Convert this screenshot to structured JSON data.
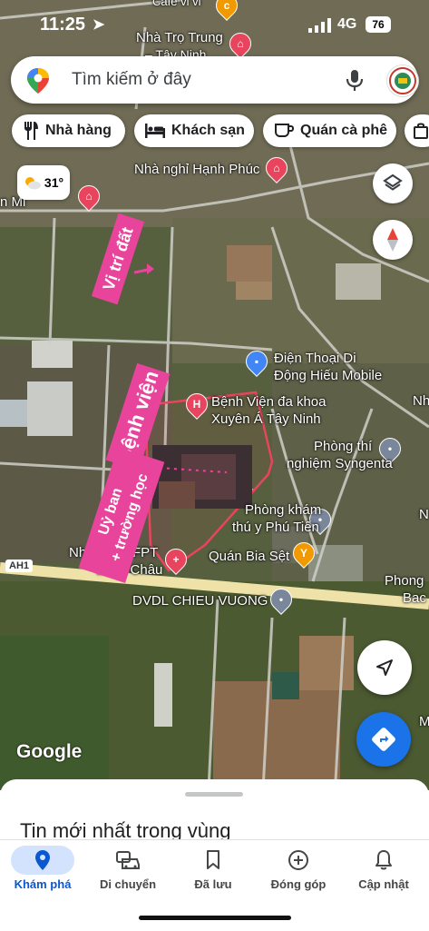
{
  "status_bar": {
    "time": "11:25",
    "network": "4G",
    "battery": "76"
  },
  "search": {
    "placeholder": "Tìm kiếm ở đây"
  },
  "chips": [
    {
      "label": "Nhà hàng",
      "icon": "fork-knife-icon"
    },
    {
      "label": "Khách sạn",
      "icon": "bed-icon"
    },
    {
      "label": "Quán cà phê",
      "icon": "coffee-cup-icon"
    }
  ],
  "weather": {
    "temp": "31°",
    "icon": "partly-sunny-icon"
  },
  "map_labels": {
    "tro_top": "Nhà Trọ Trung",
    "tro_sub": "– Tây Ninh",
    "cafe": "Cafe vi vi",
    "nha_nghi": "Nhà nghỉ Hạnh Phúc",
    "left_frag": "n Mi",
    "dien_thoai_1": "Điện Thoại Di",
    "dien_thoai_2": "Động Hiếu Mobile",
    "benh_vien_1": "Bệnh Viện đa khoa",
    "benh_vien_2": "Xuyên Á Tây Ninh",
    "phong_thi_1": "Phòng thí",
    "phong_thi_2": "nghiệm Syngenta",
    "phong_kham_1": "Phòng khám",
    "phong_kham_2": "thú y Phú Tiến",
    "quan_bia": "Quán Bia Sệt",
    "fpt_1": "Nhà Th",
    "fpt_1b": "FPT",
    "fpt_2": "Long Châu",
    "dvdl": "DVDL CHIEU VUONG",
    "ah1": "AH1",
    "phong_right": "Phong",
    "bac_right": "Bac",
    "nh_right": "Nh",
    "m_right": "M",
    "n_right": "N"
  },
  "annotations": {
    "vi_tri": "Vị trí đất",
    "benh_vien": "Bệnh viện",
    "uy_ban_1": "Uỷ ban",
    "uy_ban_2": "+ trường học"
  },
  "google_logo": "Google",
  "sheet": {
    "title": "Tin mới nhất trong vùng"
  },
  "tabs": [
    {
      "label": "Khám phá",
      "icon": "location-pin-icon",
      "active": true
    },
    {
      "label": "Di chuyển",
      "icon": "car-icon"
    },
    {
      "label": "Đã lưu",
      "icon": "bookmark-icon"
    },
    {
      "label": "Đóng góp",
      "icon": "add-circle-icon"
    },
    {
      "label": "Cập nhật",
      "icon": "bell-icon"
    }
  ],
  "colors": {
    "accent": "#1a73e8",
    "annotation_pink": "#e8449c",
    "poi_red": "#e8445e",
    "poi_blue": "#4285f4"
  }
}
